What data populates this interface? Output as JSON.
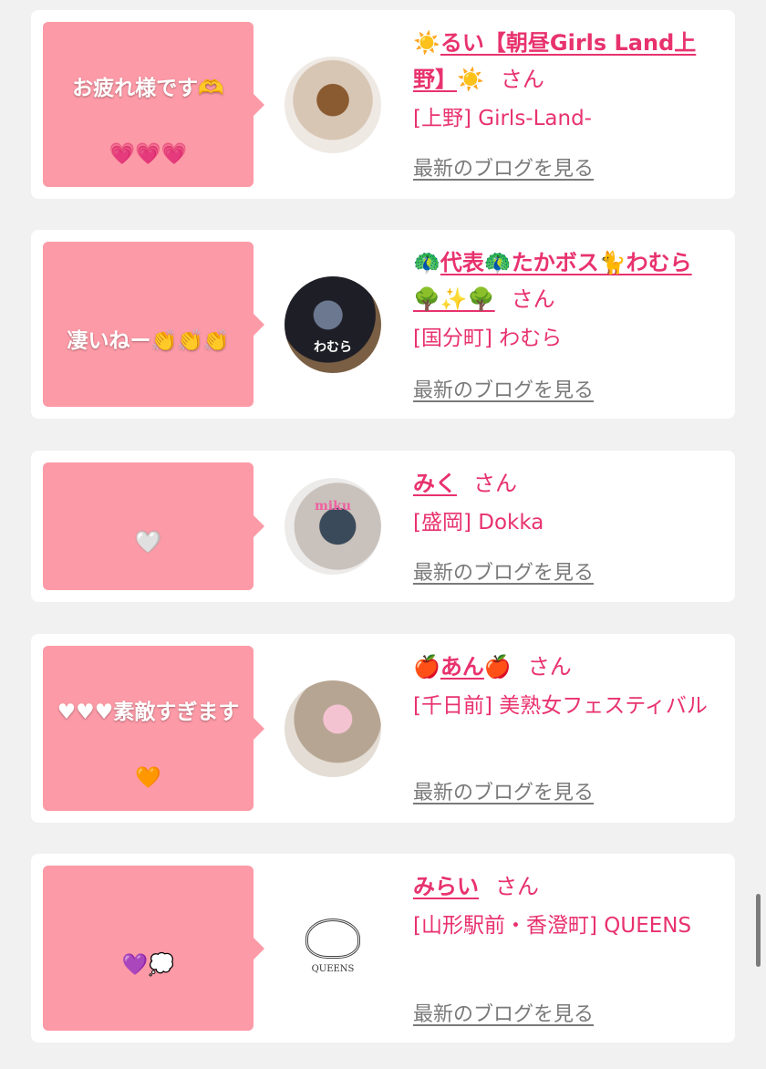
{
  "cards": [
    {
      "bubble": "お疲れ様です🫶",
      "bubble_hearts": "💗💗💗",
      "name_prefix": "☀️",
      "name": "るい【朝昼Girls Land上野】",
      "name_suffix": "☀️",
      "san": "さん",
      "area": "[上野] Girls-Land-",
      "blog_link": "最新のブログを見る"
    },
    {
      "bubble": "凄いねー👏👏👏",
      "bubble_hearts": "",
      "name_prefix": "🦚",
      "name": "代表🦚たかボス🐈わむら🌳✨🌳",
      "name_suffix": "",
      "san": "さん",
      "area": "[国分町] わむら",
      "avatar_text": "わむら",
      "blog_link": "最新のブログを見る"
    },
    {
      "bubble": "🤍",
      "bubble_hearts": "",
      "name_prefix": "",
      "name": "みく",
      "name_suffix": "",
      "san": "さん",
      "area": "[盛岡] Dokka",
      "avatar_text": "miku",
      "blog_link": "最新のブログを見る"
    },
    {
      "bubble": "♥♥♥素敵すぎます",
      "bubble_hearts": "🧡",
      "name_prefix": "🍎",
      "name": "あん",
      "name_suffix": "🍎",
      "san": "さん",
      "area": "[千日前] 美熟女フェスティバル",
      "blog_link": "最新のブログを見る"
    },
    {
      "bubble": "💜💭",
      "bubble_hearts": "",
      "name_prefix": "",
      "name": "みらい",
      "name_suffix": "",
      "san": "さん",
      "area": "[山形駅前・香澄町] QUEENS",
      "avatar_text": "QUEENS",
      "blog_link": "最新のブログを見る"
    }
  ],
  "colors": {
    "bubble_bg": "#fd9aa7",
    "accent": "#e8326e",
    "link_gray": "#7a7a7a",
    "page_bg": "#f1f1f1"
  }
}
